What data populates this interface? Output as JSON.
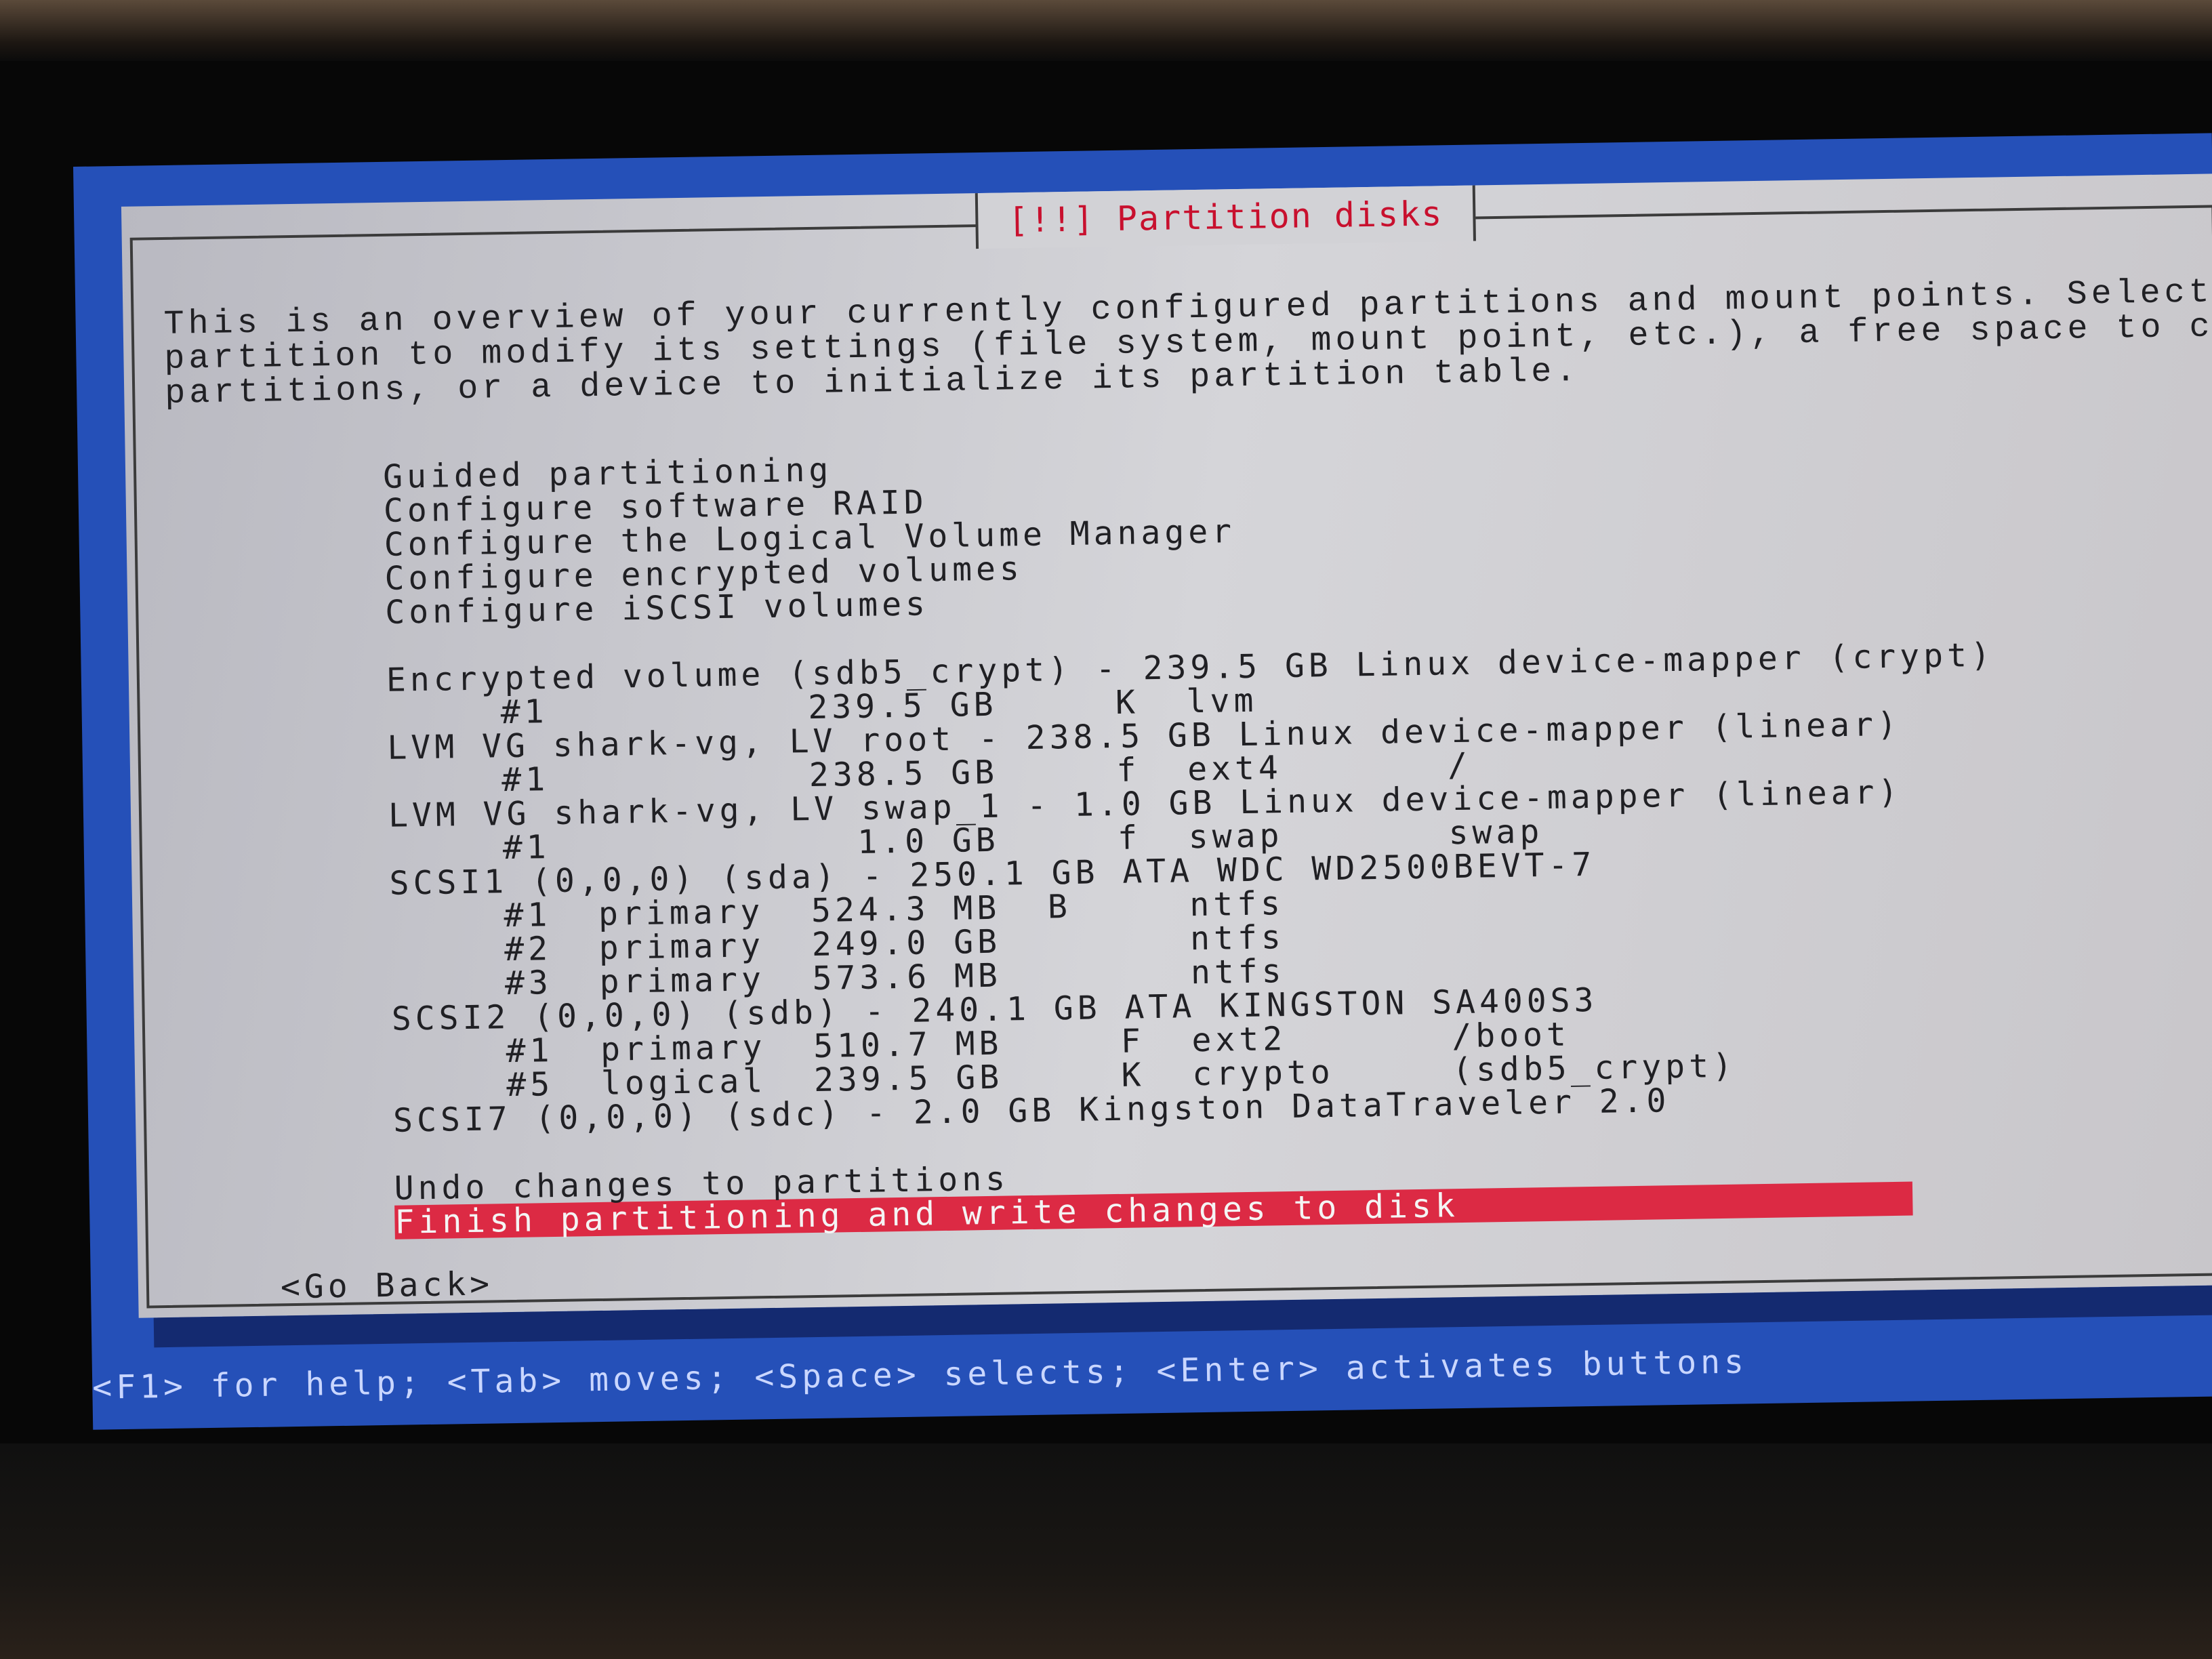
{
  "dialog": {
    "title": "[!!] Partition disks",
    "intro_lines": [
      "This is an overview of your currently configured partitions and mount points. Select a",
      "partition to modify its settings (file system, mount point, etc.), a free space to create",
      "partitions, or a device to initialize its partition table."
    ]
  },
  "menu": {
    "guided": "Guided partitioning",
    "raid": "Configure software RAID",
    "lvm": "Configure the Logical Volume Manager",
    "encrypted": "Configure encrypted volumes",
    "iscsi": "Configure iSCSI volumes"
  },
  "devices": [
    {
      "label": "Encrypted volume (sdb5_crypt) - 239.5 GB Linux device-mapper (crypt)",
      "partitions": [
        "#1           239.5 GB     K  lvm"
      ]
    },
    {
      "label": "LVM VG shark-vg, LV root - 238.5 GB Linux device-mapper (linear)",
      "partitions": [
        "#1           238.5 GB     f  ext4       /"
      ]
    },
    {
      "label": "LVM VG shark-vg, LV swap_1 - 1.0 GB Linux device-mapper (linear)",
      "partitions": [
        "#1             1.0 GB     f  swap       swap"
      ]
    },
    {
      "label": "SCSI1 (0,0,0) (sda) - 250.1 GB ATA WDC WD2500BEVT-7",
      "partitions": [
        "#1  primary  524.3 MB  B     ntfs",
        "#2  primary  249.0 GB        ntfs",
        "#3  primary  573.6 MB        ntfs"
      ]
    },
    {
      "label": "SCSI2 (0,0,0) (sdb) - 240.1 GB ATA KINGSTON SA400S3",
      "partitions": [
        "#1  primary  510.7 MB     F  ext2       /boot",
        "#5  logical  239.5 GB     K  crypto     (sdb5_crypt)"
      ]
    },
    {
      "label": "SCSI7 (0,0,0) (sdc) - 2.0 GB Kingston DataTraveler 2.0",
      "partitions": []
    }
  ],
  "actions": {
    "undo": "Undo changes to partitions",
    "finish": "Finish partitioning and write changes to disk"
  },
  "go_back": "<Go Back>",
  "help_bar": "<F1> for help; <Tab> moves; <Space> selects; <Enter> activates buttons",
  "colors": {
    "screen_blue": "#2550b8",
    "dialog_gray": "#d2d2d6",
    "title_red": "#c8102e",
    "selection_red": "#dc2a44"
  }
}
